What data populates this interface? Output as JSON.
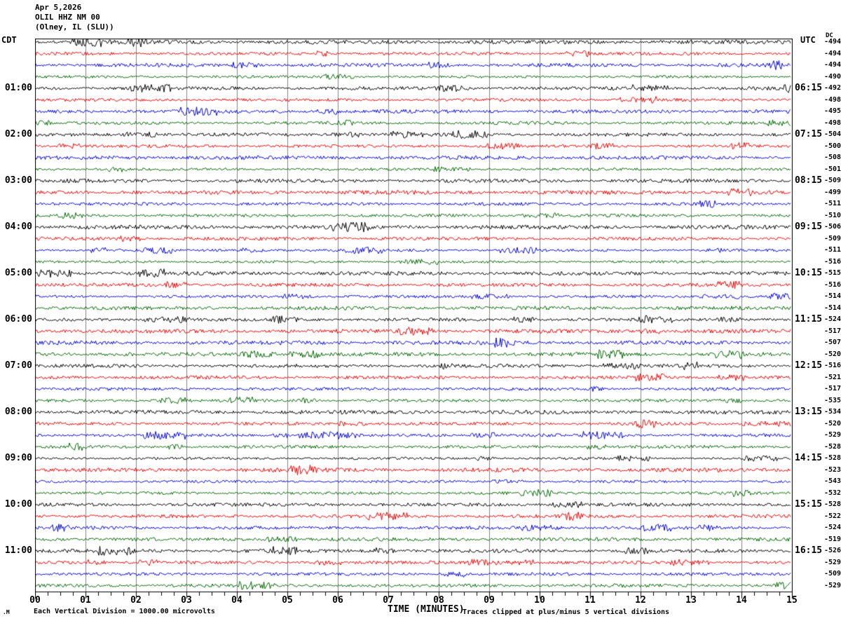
{
  "header": {
    "date": "Apr 5,2026",
    "station": "OLIL HHZ NM 00",
    "location": "(Olney, IL (SLU))"
  },
  "left_axis": {
    "label": "CDT"
  },
  "right_axis": {
    "label": "UTC",
    "dc_header": "DC"
  },
  "x_axis": {
    "title": "TIME (MINUTES)",
    "ticks": [
      "00",
      "01",
      "02",
      "03",
      "04",
      "05",
      "06",
      "07",
      "08",
      "09",
      "10",
      "11",
      "12",
      "13",
      "14",
      "15"
    ]
  },
  "footer": {
    "scale_note": "Each Vertical Division = 1000.00 microvolts",
    "clip_note": "Traces clipped at plus/minus 5 vertical divisions",
    "watermark": ".M"
  },
  "chart_data": {
    "type": "line",
    "title": "Helicorder seismogram OLIL HHZ NM 00 (Olney, IL (SLU)) Apr 5,2026",
    "x_range_minutes": [
      0,
      15
    ],
    "minutes_per_row": 15,
    "rows": 48,
    "grid": {
      "vertical_line_every_minute": true,
      "grid_color": "#808080",
      "border_color": "#000000"
    },
    "color_cycle_names": [
      "black",
      "red",
      "blue",
      "green"
    ],
    "trace_colors": [
      "#000000",
      "#ee0000",
      "#0000dd",
      "#006600"
    ],
    "left_hour_labels_cdt": [
      "01:00",
      "02:00",
      "03:00",
      "04:00",
      "05:00",
      "06:00",
      "07:00",
      "08:00",
      "09:00",
      "10:00",
      "11:00"
    ],
    "right_hour_labels_utc": [
      "06:15",
      "07:15",
      "08:15",
      "09:15",
      "10:15",
      "11:15",
      "12:15",
      "13:15",
      "14:15",
      "15:15",
      "16:15"
    ],
    "hour_label_row_step": 4,
    "hour_label_first_row_index": 4,
    "dc_values": [
      -494,
      -494,
      -494,
      -490,
      -492,
      -498,
      -495,
      -498,
      -504,
      -500,
      -508,
      -501,
      -509,
      -499,
      -511,
      -510,
      -506,
      -509,
      -511,
      -516,
      -515,
      -516,
      -514,
      -514,
      -524,
      -517,
      -507,
      -520,
      -516,
      -521,
      -517,
      -535,
      -534,
      -520,
      -529,
      -528,
      -528,
      -523,
      -543,
      -532,
      -528,
      -522,
      -524,
      -519,
      -526,
      -529,
      -509,
      -529
    ],
    "description": "Continuous microseismic background noise on all 48 15-minute traces; traces clipped at plus/minus 5 vertical divisions; each vertical division = 1000.00 microvolts"
  }
}
